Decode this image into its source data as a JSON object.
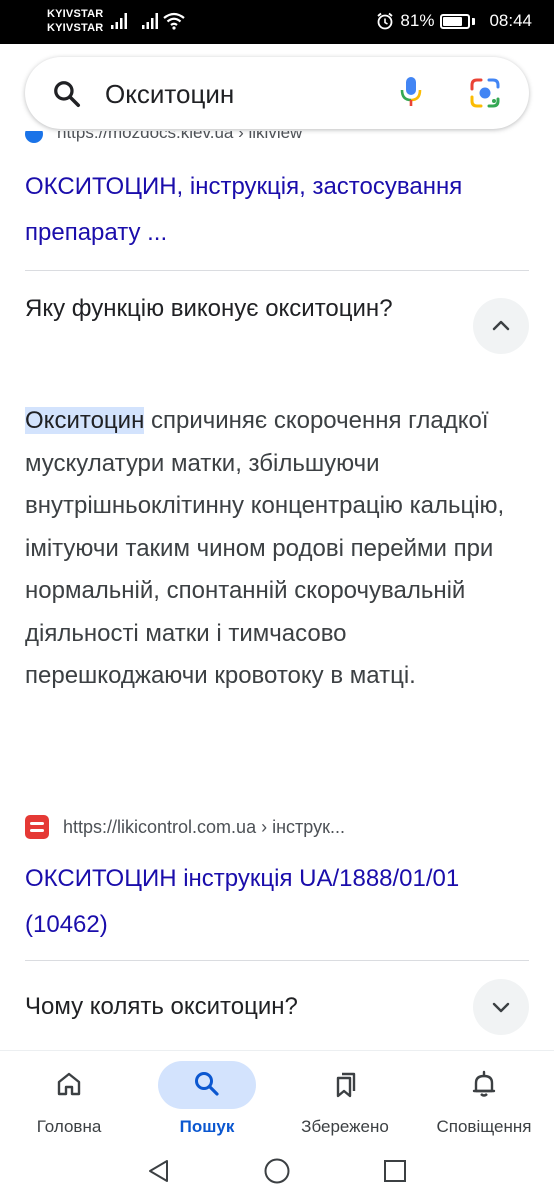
{
  "status_bar": {
    "carrier_1": "KYIVSTAR",
    "carrier_2": "KYIVSTAR",
    "battery_percent": "81%",
    "time": "08:44",
    "icons": [
      "signal-icon",
      "signal-icon",
      "wifi-icon",
      "alarm-icon",
      "battery-icon"
    ]
  },
  "search": {
    "query": "Окситоцин",
    "icons": [
      "search-icon",
      "mic-icon",
      "lens-icon"
    ]
  },
  "results": {
    "cut_url": "https://mozdocs.kiev.ua › likiview",
    "result_1_title": "ОКСИТОЦИН, інструкція, застосування препарату ...",
    "question_1": "Яку функцію виконує окситоцин?",
    "answer_highlight": "Окситоцин",
    "answer_rest": " спричиняє скорочення гладкої мускулатури матки, збільшуючи внутрішньоклітинну концентрацію кальцію, імітуючи таким чином родові перейми при нормальній, спонтанній скорочувальній діяльності матки і тимчасово перешкоджаючи кровотоку в матці.",
    "source_url": "https://likicontrol.com.ua › інструк...",
    "result_2_title": "ОКСИТОЦИН інструкція UA/1888/01/01 (10462)",
    "question_2": "Чому колять окситоцин?"
  },
  "bottom_nav": {
    "items": [
      {
        "label": "Головна",
        "icon": "home-icon",
        "active": false
      },
      {
        "label": "Пошук",
        "icon": "search-icon",
        "active": true
      },
      {
        "label": "Збережено",
        "icon": "bookmark-icon",
        "active": false
      },
      {
        "label": "Сповіщення",
        "icon": "bell-icon",
        "active": false
      }
    ]
  },
  "system_nav": {
    "icons": [
      "back-icon",
      "home-circle-icon",
      "recents-icon"
    ]
  },
  "colors": {
    "link": "#1a0dab",
    "accent": "#0b57d0",
    "highlight": "#d3e3fd",
    "status_bar_bg": "#000000"
  }
}
